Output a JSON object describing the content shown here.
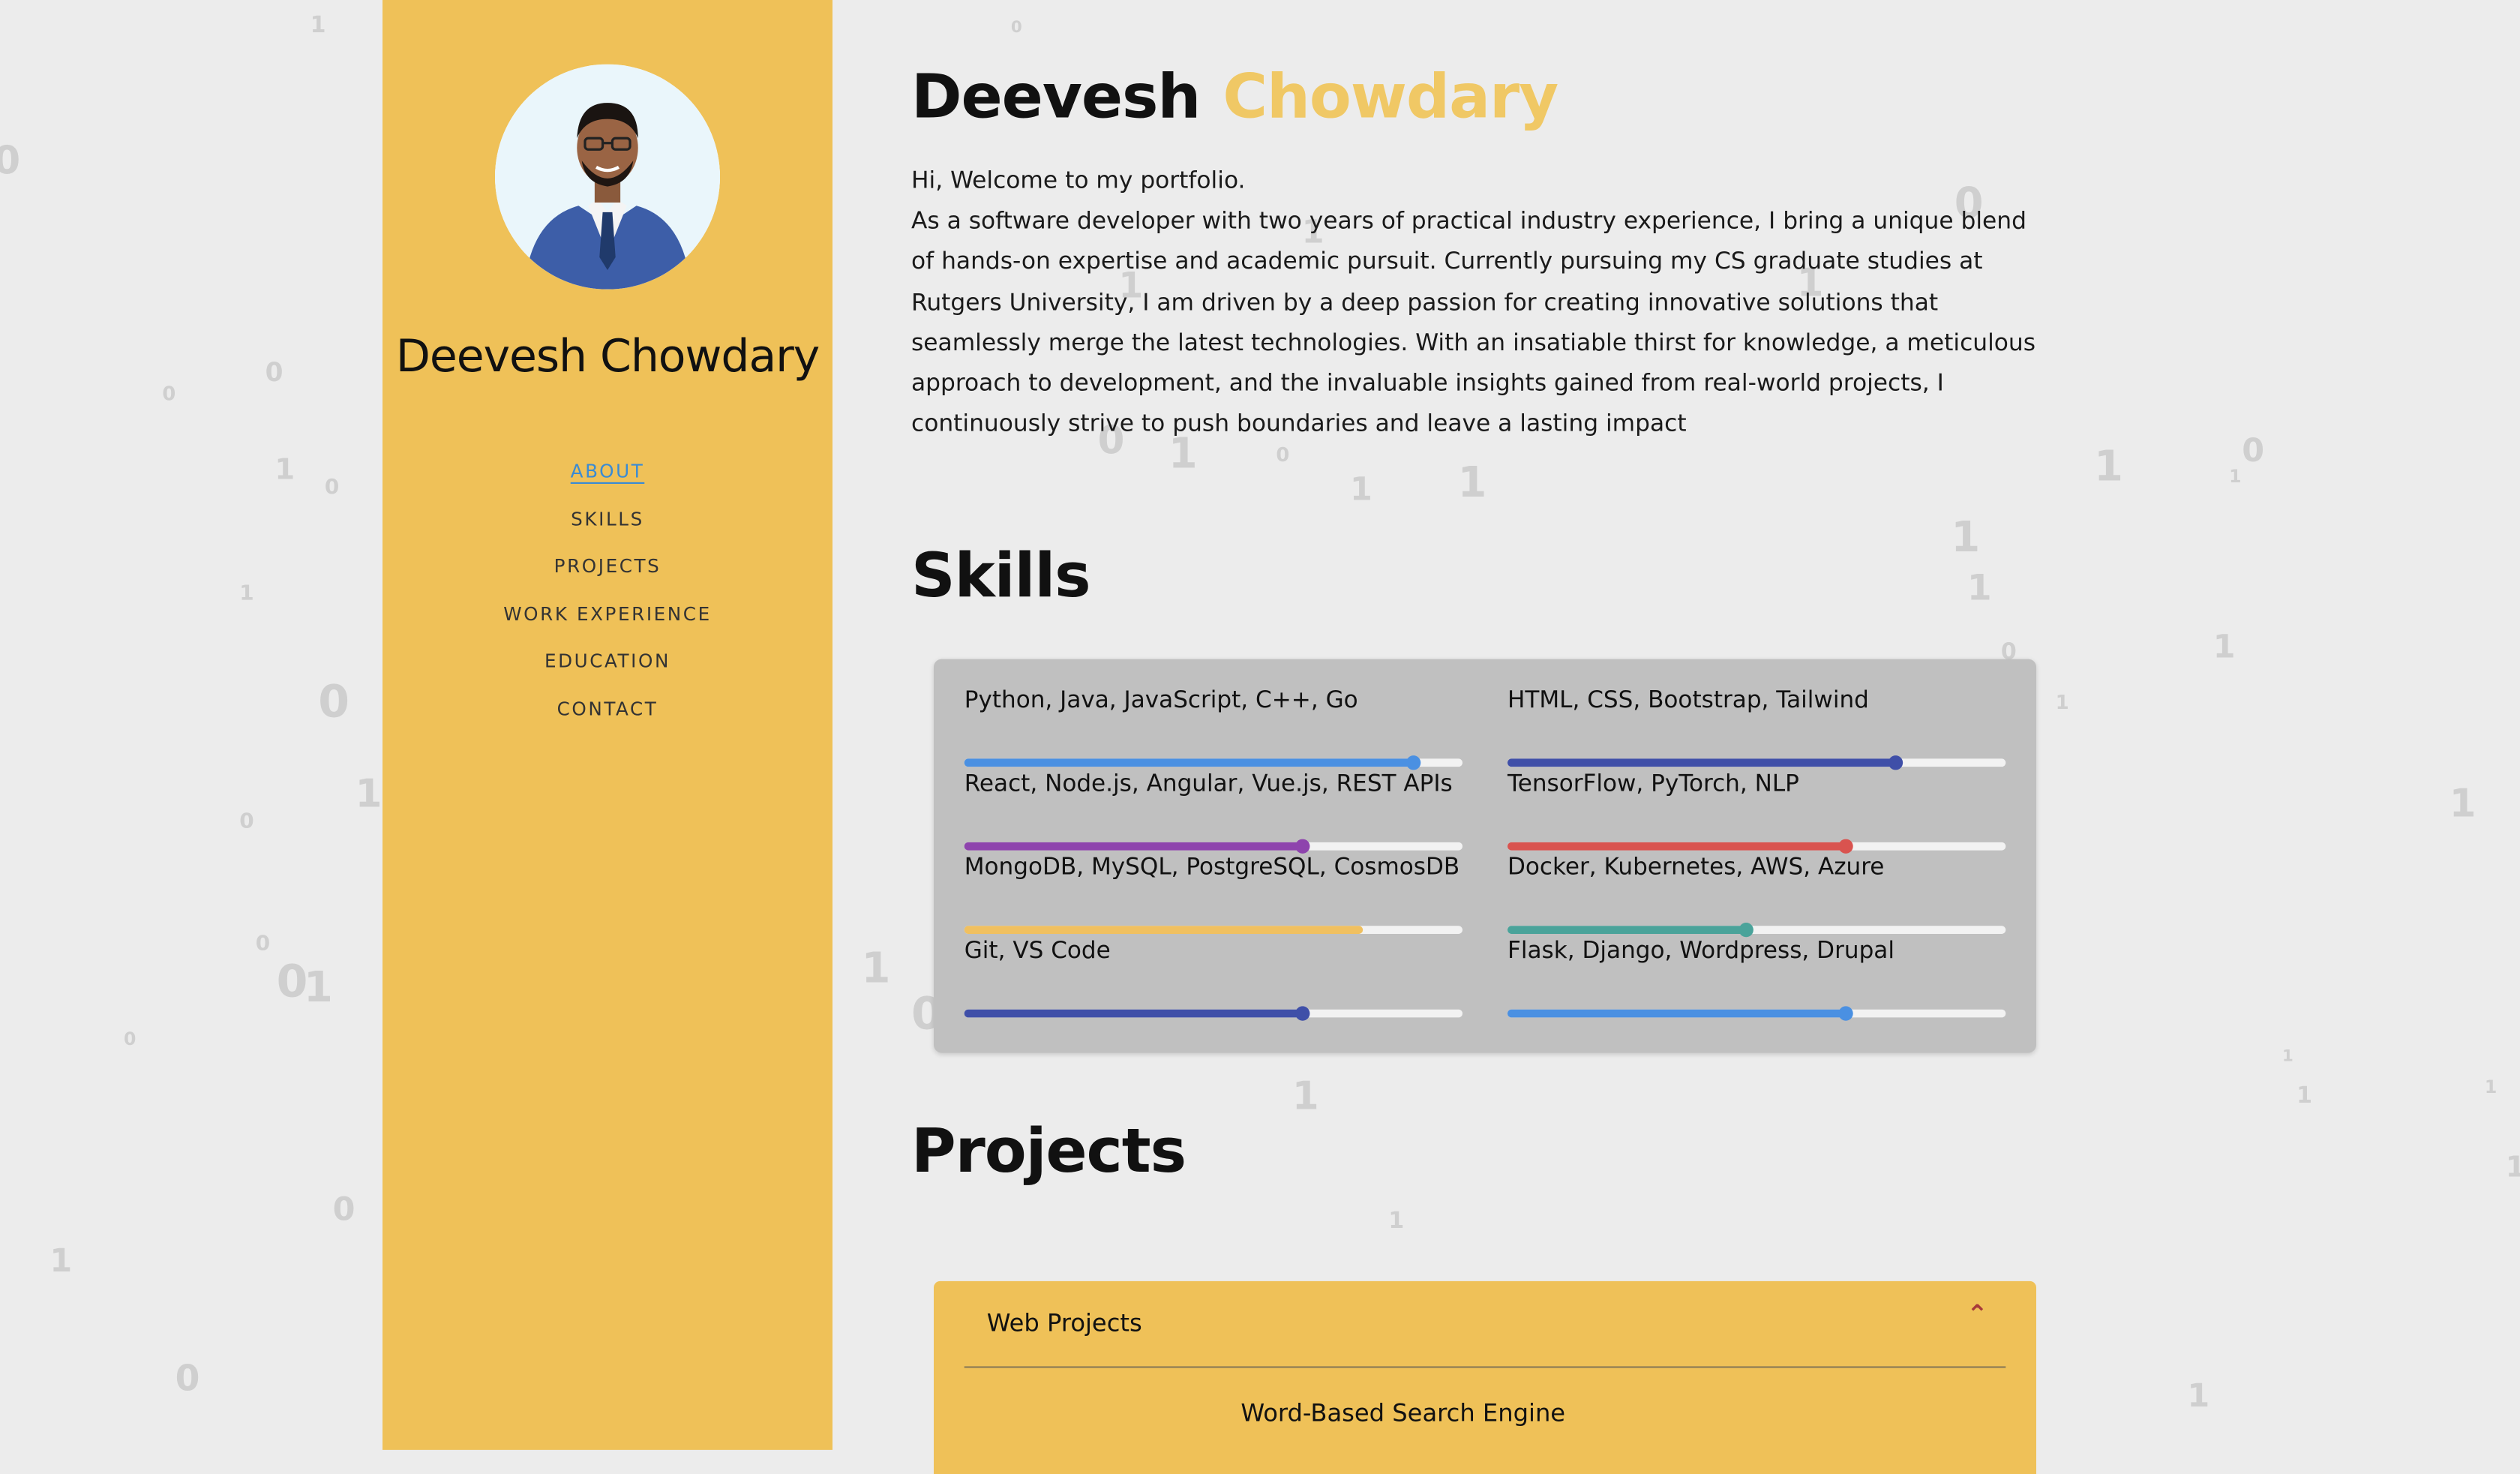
{
  "sidebar": {
    "name": "Deevesh Chowdary",
    "nav": [
      {
        "label": "ABOUT",
        "active": true
      },
      {
        "label": "SKILLS"
      },
      {
        "label": "PROJECTS"
      },
      {
        "label": "WORK EXPERIENCE"
      },
      {
        "label": "EDUCATION"
      },
      {
        "label": "CONTACT"
      }
    ]
  },
  "header": {
    "first_name": "Deevesh",
    "last_name": "Chowdary"
  },
  "intro": {
    "greeting": "Hi, Welcome to my portfolio.",
    "body": "As a software developer with two years of practical industry experience, I bring a unique blend of hands-on expertise and academic pursuit. Currently pursuing my CS graduate studies at Rutgers University, I am driven by a deep passion for creating innovative solutions that seamlessly merge the latest technologies. With an insatiable thirst for knowledge, a meticulous approach to development, and the invaluable insights gained from real-world projects, I continuously strive to push boundaries and leave a lasting impact"
  },
  "skills": {
    "title": "Skills",
    "items": [
      {
        "label": "Python, Java, JavaScript, C++, Go",
        "level": 0.9,
        "color": "#4a90e2",
        "knob": true
      },
      {
        "label": "HTML, CSS, Bootstrap, Tailwind",
        "level": 0.78,
        "color": "#3f4fa8",
        "knob": true
      },
      {
        "label": "React, Node.js, Angular, Vue.js, REST APIs",
        "level": 0.68,
        "color": "#8e44ad",
        "knob": true
      },
      {
        "label": "TensorFlow, PyTorch, NLP",
        "level": 0.68,
        "color": "#d9534f",
        "knob": true
      },
      {
        "label": "MongoDB, MySQL, PostgreSQL, CosmosDB",
        "level": 0.8,
        "color": "#f0c060",
        "knob": false
      },
      {
        "label": "Docker, Kubernetes, AWS, Azure",
        "level": 0.48,
        "color": "#4aa39a",
        "knob": true
      },
      {
        "label": "Git, VS Code",
        "level": 0.68,
        "color": "#3f4fa8",
        "knob": true
      },
      {
        "label": "Flask, Django, Wordpress, Drupal",
        "level": 0.68,
        "color": "#4a90e2",
        "knob": true
      }
    ]
  },
  "projects": {
    "title": "Projects",
    "accordion_label": "Web Projects",
    "first_item": "Word-Based Search Engine"
  },
  "colors": {
    "sidebar": "#efc158",
    "accent": "#f0c865",
    "link": "#3a8bd4",
    "background": "#ececec"
  },
  "icons": {
    "accordion_toggle": "chevron-up-icon"
  }
}
